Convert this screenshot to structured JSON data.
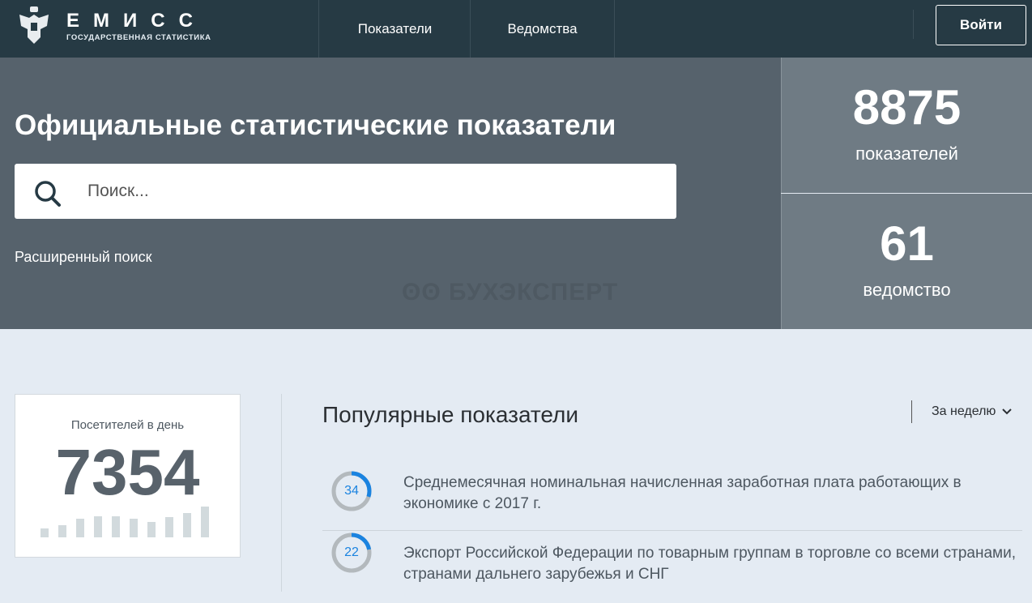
{
  "header": {
    "brand": "ЕМИСС",
    "brand_subtitle": "ГОСУДАРСТВЕННАЯ СТАТИСТИКА",
    "nav": [
      "Показатели",
      "Ведомства"
    ],
    "login": "Войти"
  },
  "hero": {
    "title": "Официальные статистические показатели",
    "search_placeholder": "Поиск...",
    "advanced_search": "Расширенный поиск",
    "watermark": "БУХЭКСПЕРТ"
  },
  "stats": [
    {
      "value": "8875",
      "label": "показателей"
    },
    {
      "value": "61",
      "label": "ведомство"
    }
  ],
  "visitors": {
    "label": "Посетителей в день",
    "value": "7354",
    "bars": [
      11,
      15,
      23,
      26,
      26,
      23,
      19,
      25,
      30,
      38
    ]
  },
  "popular": {
    "title": "Популярные показатели",
    "filter": "За неделю",
    "items": [
      {
        "score": "34",
        "fraction": 0.3,
        "text": "Среднемесячная номинальная начисленная заработная плата работающих в экономике с 2017 г."
      },
      {
        "score": "22",
        "fraction": 0.22,
        "text": "Экспорт Российской Федерации по товарным группам в торговле со всеми странами, странами дальнего зарубежья и СНГ"
      }
    ]
  },
  "colors": {
    "header": "#263a44",
    "hero": "#56626c",
    "accent": "#1a83e0"
  }
}
